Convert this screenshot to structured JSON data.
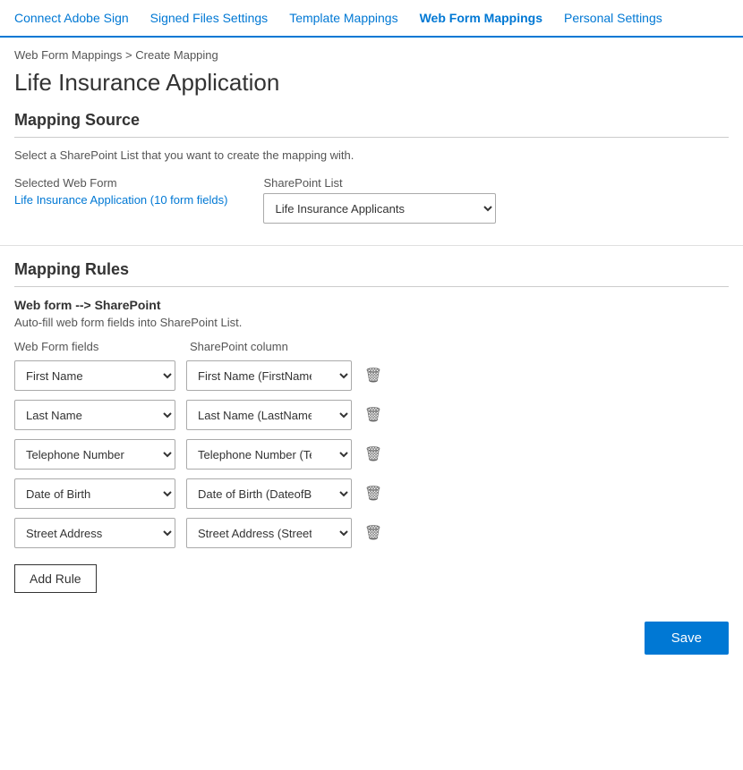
{
  "nav": {
    "items": [
      {
        "label": "Connect Adobe Sign",
        "active": false
      },
      {
        "label": "Signed Files Settings",
        "active": false
      },
      {
        "label": "Template Mappings",
        "active": false
      },
      {
        "label": "Web Form Mappings",
        "active": true
      },
      {
        "label": "Personal Settings",
        "active": false
      }
    ]
  },
  "breadcrumb": {
    "root": "Web Form Mappings",
    "separator": ">",
    "current": "Create Mapping"
  },
  "page_title": "Life Insurance Application",
  "mapping_source": {
    "section_title": "Mapping Source",
    "description": "Select a SharePoint List that you want to create the mapping with.",
    "selected_web_form_label": "Selected Web Form",
    "selected_web_form_value": "Life Insurance Application (10 form fields)",
    "sharepoint_list_label": "SharePoint List",
    "sharepoint_list_selected": "Life Insurance Applicants",
    "sharepoint_list_options": [
      "Life Insurance Applicants"
    ]
  },
  "mapping_rules": {
    "section_title": "Mapping Rules",
    "direction_label": "Web form --> SharePoint",
    "auto_fill_desc": "Auto-fill web form fields into SharePoint List.",
    "webform_fields_header": "Web Form fields",
    "sharepoint_column_header": "SharePoint column",
    "rules": [
      {
        "webform_field": "First Name",
        "sharepoint_col": "First Name (FirstName)"
      },
      {
        "webform_field": "Last Name",
        "sharepoint_col": "Last Name (LastName)"
      },
      {
        "webform_field": "Telephone Number",
        "sharepoint_col": "Telephone Number (Tele..."
      },
      {
        "webform_field": "Date of Birth",
        "sharepoint_col": "Date of Birth (DateofBirth)"
      },
      {
        "webform_field": "Street Address",
        "sharepoint_col": "Street Address (StreetAd..."
      }
    ],
    "webform_field_options": [
      "First Name",
      "Last Name",
      "Telephone Number",
      "Date of Birth",
      "Street Address"
    ],
    "sharepoint_col_options_0": [
      "First Name (FirstName)"
    ],
    "sharepoint_col_options_1": [
      "Last Name (LastName)"
    ],
    "sharepoint_col_options_2": [
      "Telephone Number (Tele..."
    ],
    "sharepoint_col_options_3": [
      "Date of Birth (DateofBirth)"
    ],
    "sharepoint_col_options_4": [
      "Street Address (StreetAd..."
    ],
    "add_rule_label": "Add Rule"
  },
  "save_button_label": "Save"
}
